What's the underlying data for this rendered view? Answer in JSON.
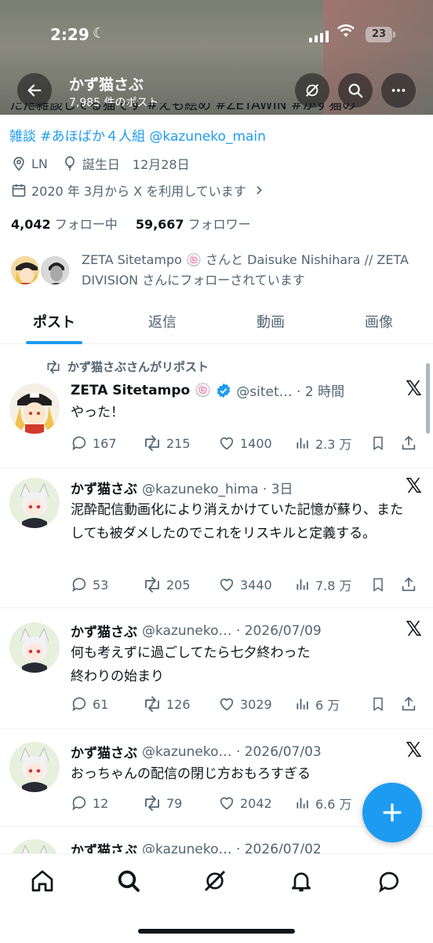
{
  "status_bar": {
    "time": "2:29",
    "battery": "23"
  },
  "header": {
    "name": "かず猫さぶ",
    "post_count": "7,985 件のポスト"
  },
  "bio": {
    "partial_line": "ただ雑談してる猫です #えも絵め #ZETAWIN #かず猫の",
    "line2_tag1": "雑談",
    "line2_tag2": "#あほばか４人組",
    "line2_mention": "@kazuneko_main",
    "location": "LN",
    "birthday": "誕生日　12月28日",
    "joined": "2020 年 3月から X を利用しています"
  },
  "follow": {
    "following_count": "4,042",
    "following_label": "フォロー中",
    "followers_count": "59,667",
    "followers_label": "フォロワー"
  },
  "followed_by_text": "ZETA Sitetampo 🍥 さんと Daisuke Nishihara // ZETA DIVISION さんにフォローされています",
  "tabs": [
    "ポスト",
    "返信",
    "動画",
    "画像"
  ],
  "repost_label": "かず猫さぶさんがリポスト",
  "posts": [
    {
      "name": "ZETA Sitetampo 🍥",
      "handle": "@sitet… · 2 時間",
      "text": "やった！",
      "replies": "167",
      "reposts": "215",
      "likes": "1400",
      "views": "2.3 万"
    },
    {
      "name": "かず猫さぶ",
      "handle": "@kazuneko_hima · 3日",
      "text": "泥酔配信動画化により消えかけていた記憶が蘇り、またしても被ダメしたのでこれをリスキルと定義する。",
      "replies": "53",
      "reposts": "205",
      "likes": "3440",
      "views": "7.8 万"
    },
    {
      "name": "かず猫さぶ",
      "handle": "@kazuneko… · 2026/07/09",
      "text": "何も考えずに過ごしてたら七夕終わった\n終わりの始まり",
      "replies": "61",
      "reposts": "126",
      "likes": "3029",
      "views": "6 万"
    },
    {
      "name": "かず猫さぶ",
      "handle": "@kazuneko… · 2026/07/03",
      "text": "おっちゃんの配信の閉じ方おもろすぎる",
      "replies": "12",
      "reposts": "79",
      "likes": "2042",
      "views": "6.6 万"
    },
    {
      "name": "かず猫さぶ",
      "handle": "@kazuneko… · 2026/07/02"
    }
  ],
  "colors": {
    "accent": "#1d9bf0",
    "text": "#0f1419",
    "muted": "#536471",
    "verified": "#1d9bf0"
  }
}
